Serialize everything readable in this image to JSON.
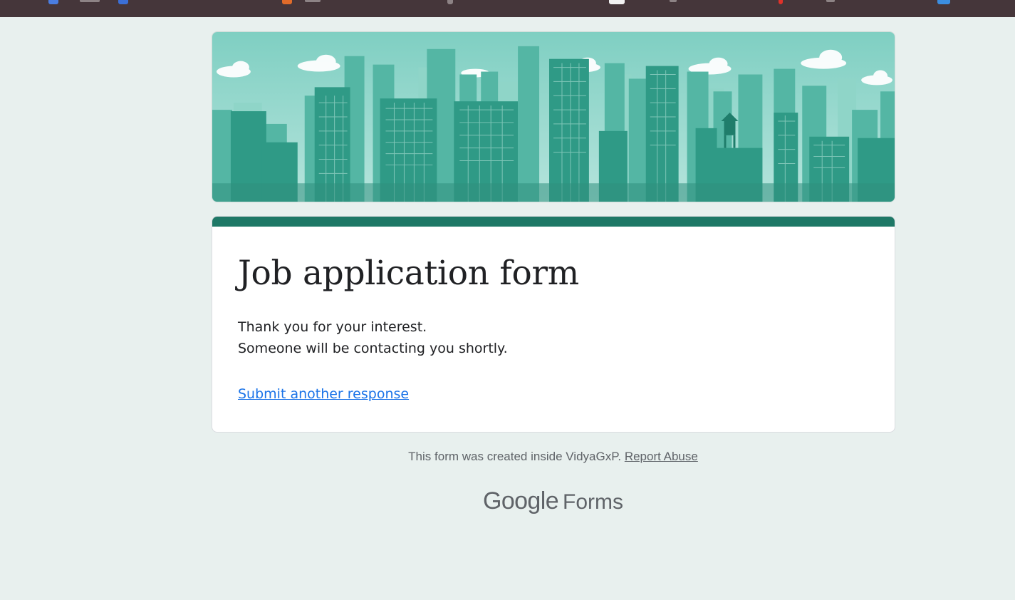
{
  "form": {
    "title": "Job application form",
    "confirmation_lines": [
      "Thank you for your interest.",
      "Someone will be contacting you shortly."
    ],
    "submit_another_label": "Submit another response"
  },
  "footer": {
    "note": "This form was created inside VidyaGxP.",
    "report_abuse_label": "Report Abuse",
    "brand_google": "Google",
    "brand_forms": "Forms"
  },
  "colors": {
    "page_background": "#e8f0ee",
    "accent": "#1e7866",
    "link": "#1a73e8"
  },
  "banner": {
    "theme": "city-skyline-illustration"
  }
}
